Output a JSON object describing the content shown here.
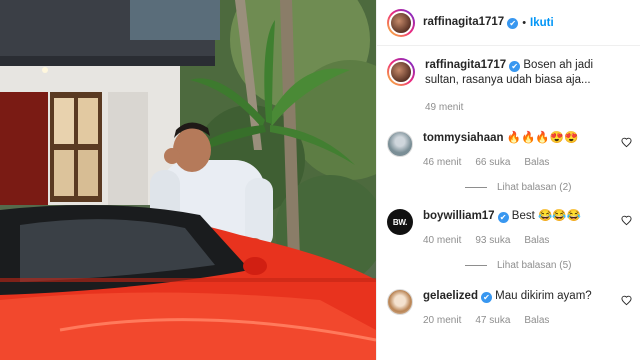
{
  "header": {
    "username": "raffinagita1717",
    "separator": "•",
    "follow_label": "Ikuti"
  },
  "caption": {
    "username": "raffinagita1717",
    "text": "Bosen ah jadi sultan, rasanya udah biasa aja...",
    "time": "49 menit"
  },
  "comments": [
    {
      "username": "tommysiahaan",
      "text": "🔥🔥🔥😍😍",
      "time": "46 menit",
      "likes": "66 suka",
      "reply_label": "Balas",
      "view_replies": "Lihat balasan (2)",
      "avatar_icon": "user-avatar"
    },
    {
      "username": "boywilliam17",
      "text": "Best 😂😂😂",
      "time": "40 menit",
      "likes": "93 suka",
      "reply_label": "Balas",
      "view_replies": "Lihat balasan (5)",
      "avatar_text": "BW."
    },
    {
      "username": "gelaelized",
      "text": "Mau dikirim ayam?",
      "time": "20 menit",
      "likes": "47 suka",
      "reply_label": "Balas",
      "avatar_icon": "user-avatar"
    }
  ],
  "icons": {
    "verified": "✔",
    "like": "heart-outline-icon"
  },
  "colors": {
    "link_blue": "#0095f6",
    "verified_blue": "#3897f0",
    "muted_text": "#8e8e8e",
    "car_red": "#e8331e"
  }
}
